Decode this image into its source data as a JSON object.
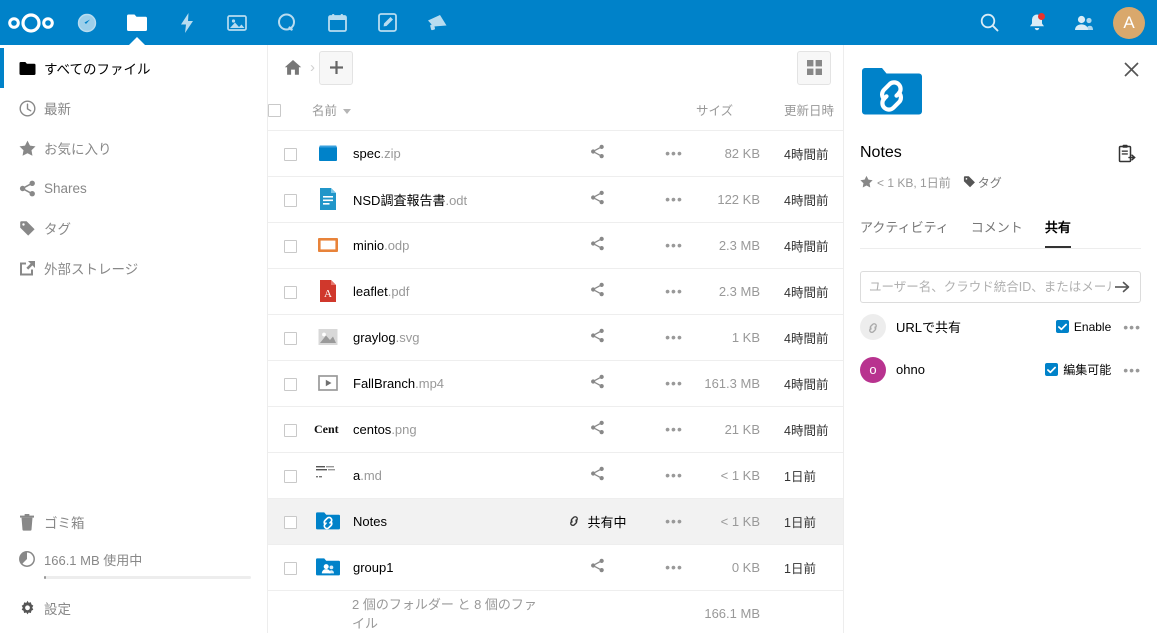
{
  "header": {
    "logo": "nextcloud-logo",
    "apps": [
      {
        "name": "dashboard",
        "icon": "dashboard-icon",
        "active": false
      },
      {
        "name": "files",
        "icon": "folder-icon",
        "active": true
      },
      {
        "name": "activity",
        "icon": "lightning-icon",
        "active": false
      },
      {
        "name": "photos",
        "icon": "image-icon",
        "active": false
      },
      {
        "name": "search",
        "icon": "circle-search-icon",
        "active": false
      },
      {
        "name": "calendar",
        "icon": "calendar-icon",
        "active": false
      },
      {
        "name": "notes",
        "icon": "pencil-icon",
        "active": false
      },
      {
        "name": "announcements",
        "icon": "megaphone-icon",
        "active": false
      }
    ],
    "right": {
      "search_icon": "search-icon",
      "notifications_icon": "bell-icon",
      "notification_badge": true,
      "contacts_icon": "contacts-icon",
      "avatar_initial": "A",
      "avatar_color": "#d9a86c"
    },
    "accent_color": "#0082c9"
  },
  "sidebar": {
    "items": [
      {
        "label": "すべてのファイル",
        "icon": "folder-icon",
        "active": true
      },
      {
        "label": "最新",
        "icon": "clock-icon",
        "active": false
      },
      {
        "label": "お気に入り",
        "icon": "star-icon",
        "active": false
      },
      {
        "label": "Shares",
        "icon": "share-icon",
        "active": false
      },
      {
        "label": "タグ",
        "icon": "tag-icon",
        "active": false
      },
      {
        "label": "外部ストレージ",
        "icon": "external-link-icon",
        "active": false
      }
    ],
    "bottom": {
      "trash_label": "ゴミ箱",
      "trash_icon": "trash-icon",
      "quota_label": "166.1 MB 使用中",
      "quota_icon": "pie-icon",
      "quota_percent": 1,
      "settings_label": "設定",
      "settings_icon": "gear-icon"
    }
  },
  "main": {
    "breadcrumb": {
      "home_icon": "home-icon",
      "separator": "›"
    },
    "new_button": "+",
    "grid_toggle_icon": "grid-icon",
    "columns": {
      "select_all": "select-all-checkbox",
      "name": "名前",
      "size": "サイズ",
      "modified": "更新日時"
    },
    "files": [
      {
        "name": "spec",
        "ext": ".zip",
        "icon": "archive-icon",
        "share": "share-icon",
        "size": "82 KB",
        "modified": "4時間前",
        "selected": false
      },
      {
        "name": "NSD調査報告書",
        "ext": ".odt",
        "icon": "document-icon",
        "share": "share-icon",
        "size": "122 KB",
        "modified": "4時間前",
        "selected": false
      },
      {
        "name": "minio",
        "ext": ".odp",
        "icon": "presentation-icon",
        "share": "share-icon",
        "size": "2.3 MB",
        "modified": "4時間前",
        "selected": false
      },
      {
        "name": "leaflet",
        "ext": ".pdf",
        "icon": "pdf-icon",
        "share": "share-icon",
        "size": "2.3 MB",
        "modified": "4時間前",
        "selected": false
      },
      {
        "name": "graylog",
        "ext": ".svg",
        "icon": "image-file-icon",
        "share": "share-icon",
        "size": "1 KB",
        "modified": "4時間前",
        "selected": false
      },
      {
        "name": "FallBranch",
        "ext": ".mp4",
        "icon": "video-icon",
        "share": "share-icon",
        "size": "161.3 MB",
        "modified": "4時間前",
        "selected": false
      },
      {
        "name": "centos",
        "ext": ".png",
        "icon": "centos-thumbnail",
        "share": "share-icon",
        "size": "21 KB",
        "modified": "4時間前",
        "selected": false
      },
      {
        "name": "a",
        "ext": ".md",
        "icon": "text-thumbnail",
        "share": "share-icon",
        "size": "< 1 KB",
        "modified": "1日前",
        "selected": false
      },
      {
        "name": "Notes",
        "ext": "",
        "icon": "shared-link-folder-icon",
        "share": "共有中",
        "share_icon": "link-icon",
        "size": "< 1 KB",
        "modified": "1日前",
        "selected": true
      },
      {
        "name": "group1",
        "ext": "",
        "icon": "group-folder-icon",
        "share": "share-icon",
        "size": "0 KB",
        "modified": "1日前",
        "selected": false
      }
    ],
    "footer": {
      "summary": "2 個のフォルダー と 8 個のファイル",
      "total_size": "166.1 MB"
    }
  },
  "details": {
    "close_icon": "close-icon",
    "file_icon": "shared-link-folder-icon",
    "title": "Notes",
    "copy_icon": "move-copy-icon",
    "favorite_icon": "star-icon",
    "meta": "< 1 KB, 1日前",
    "tag_icon": "tag-icon",
    "tag_label": "タグ",
    "tabs": [
      {
        "label": "アクティビティ",
        "active": false
      },
      {
        "label": "コメント",
        "active": false
      },
      {
        "label": "共有",
        "active": true
      }
    ],
    "share_input_placeholder": "ユーザー名、クラウド統合ID、またはメール...",
    "share_input_value": "",
    "submit_icon": "arrow-right-icon",
    "shares": [
      {
        "label": "URLで共有",
        "avatar": "link-icon",
        "avatar_type": "link",
        "avatar_initial": "",
        "permission": "Enable",
        "checked": true,
        "menu": "•••"
      },
      {
        "label": "ohno",
        "avatar": "user-avatar",
        "avatar_type": "user",
        "avatar_initial": "o",
        "avatar_color": "#b8338f",
        "permission": "編集可能",
        "checked": true,
        "menu": "•••"
      }
    ]
  }
}
